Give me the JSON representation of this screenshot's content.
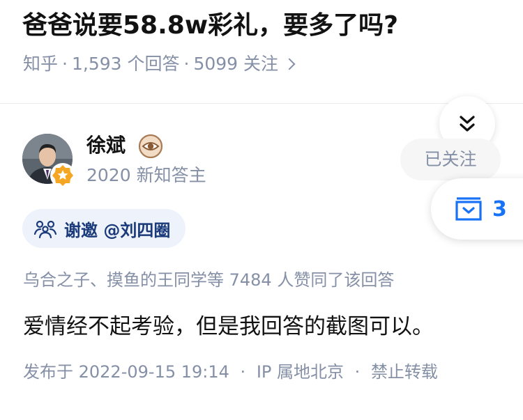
{
  "question": {
    "title": "爸爸说要58.8w彩礼，要多了吗?",
    "source": "知乎",
    "answers": "1,593 个回答",
    "followers": "5099 关注"
  },
  "author": {
    "name": "徐斌",
    "subtitle": "2020 新知答主",
    "follow_label": "已关注"
  },
  "invite": {
    "label": "谢邀 @刘四圈"
  },
  "collect": {
    "count": "3"
  },
  "answer": {
    "upvotes_line": "乌合之子、摸鱼的王同学等 7484 人赞同了该回答",
    "text": "爱情经不起考验，但是我回答的截图可以。",
    "published": "发布于 2022-09-15 19:14",
    "ip": "IP 属地北京",
    "copyright": "禁止转载"
  },
  "icons": {
    "collapse": "double-chevron-down-icon",
    "collect": "collection-box-icon",
    "invite": "people-group-icon",
    "level": "eye-badge-icon",
    "verified": "star-badge-icon"
  },
  "colors": {
    "accent": "#1772f6",
    "meta_gray": "#8590a6",
    "text": "#121212"
  }
}
